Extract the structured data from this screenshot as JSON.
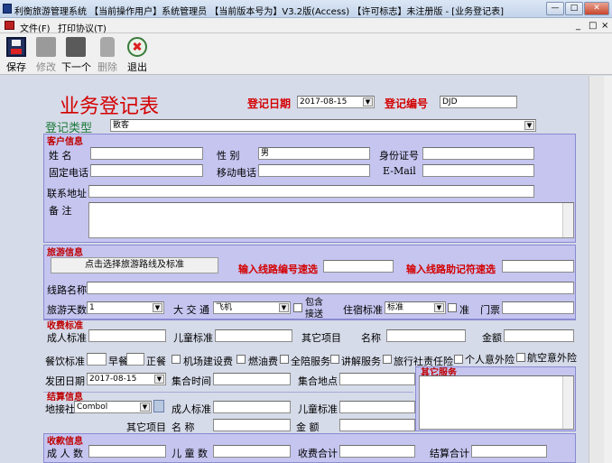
{
  "window": {
    "title": "利衡旅游管理系统  【当前操作用户】系统管理员  【当前版本号为】V3.2版(Access)  【许可标志】未注册版 - [业务登记表]",
    "controls": [
      "—",
      "□",
      "✕"
    ],
    "mdi_controls": [
      "_",
      "□",
      "×"
    ]
  },
  "menu": [
    "文件(F)",
    "打印协议(T)"
  ],
  "toolbar": [
    {
      "label": "保存",
      "icon": "floppy-disk-icon",
      "enabled": true
    },
    {
      "label": "修改",
      "icon": "edit-icon",
      "enabled": false
    },
    {
      "label": "下一个",
      "icon": "next-icon",
      "enabled": true
    },
    {
      "label": "删除",
      "icon": "trash-icon",
      "enabled": false
    },
    {
      "label": "退出",
      "icon": "exit-icon",
      "enabled": true
    }
  ],
  "form": {
    "title": "业务登记表",
    "reg_date_label": "登记日期",
    "reg_date": "2017-08-15",
    "reg_no_label": "登记编号",
    "reg_no": "DJD",
    "reg_type_label": "登记类型",
    "reg_type": "散客",
    "customer": {
      "title": "客户信息",
      "name": "姓    名",
      "sex": "性    别",
      "sex_value": "男",
      "id_card": "身份证号",
      "phone": "固定电话",
      "mobile": "移动电话",
      "email": "E-Mail",
      "address": "联系地址",
      "remark": "备    注"
    },
    "route": {
      "title": "旅游信息",
      "select_btn": "点击选择旅游路线及标准",
      "route_code": "输入线路编号速选",
      "route_mnemonic": "输入线路助记符速选",
      "route_name": "线路名称",
      "days": "旅游天数",
      "days_value": "1",
      "transport": "大 交 通",
      "transport_value": "飞机",
      "include_insurance_top": "包含",
      "include_insurance_bottom": "接送",
      "hotel_std": "住宿标准",
      "hotel_value": "标准",
      "zhun": "准",
      "ticket": "门票"
    },
    "fee": {
      "title": "收费标准",
      "adult": "成人标准",
      "child": "儿童标准",
      "other": "其它项目",
      "name": "名称",
      "amount": "金额"
    },
    "meal": {
      "std": "餐饮标准",
      "breakfast": "早餐",
      "lunch": "正餐",
      "checks": [
        "机场建设费",
        "燃油费",
        "全陪服务",
        "讲解服务",
        "旅行社责任险",
        "个人意外险",
        "航空意外险"
      ]
    },
    "depart": {
      "date_label": "发团日期",
      "date": "2017-08-15",
      "time": "集合时间",
      "place": "集合地点"
    },
    "other_service": "其它服务",
    "settle": {
      "title": "结算信息",
      "agency": "地接社",
      "agency_value": "Combol",
      "adult": "成人标准",
      "child": "儿童标准",
      "other": "其它项目",
      "name": "名    称",
      "amount": "金    额"
    },
    "receipt": {
      "title": "收款信息",
      "adult": "成 人 数",
      "child": "儿 童 数",
      "total": "收费合计",
      "settle_total": "结算合计"
    }
  }
}
